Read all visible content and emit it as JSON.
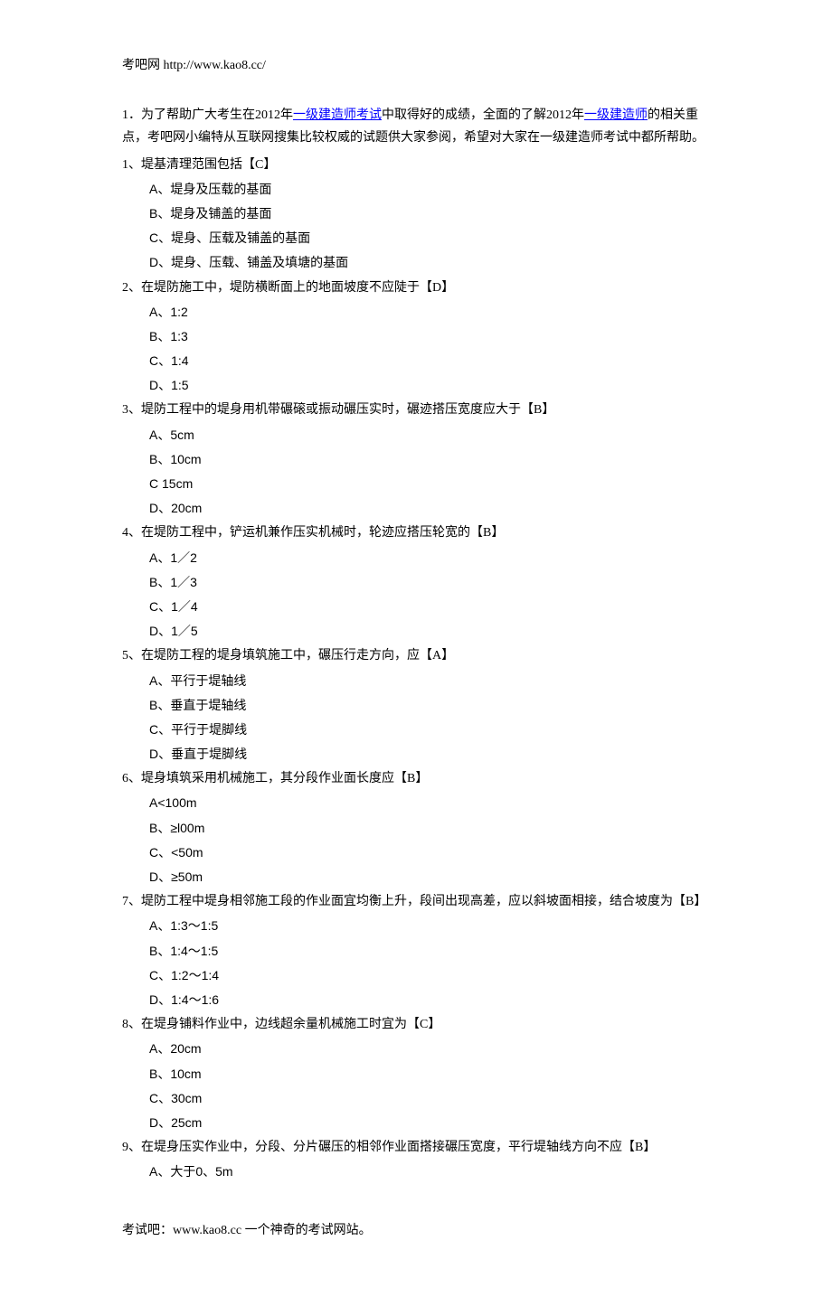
{
  "header": {
    "site_label": "考吧网 http://www.kao8.cc/"
  },
  "intro": {
    "prefix": "1．为了帮助广大考生在2012年",
    "link1_text": "一级建造师考试",
    "mid1": "中取得好的成绩，全面的了解2012年",
    "link2_text": "一级建造师",
    "suffix": "的相关重点，考吧网小编特从互联网搜集比较权威的试题供大家参阅，希望对大家在一级建造师考试中都所帮助。"
  },
  "questions": [
    {
      "stem": "1、堤基清理范围包括【C】",
      "options": [
        "A、堤身及压载的基面",
        "B、堤身及铺盖的基面",
        "C、堤身、压载及铺盖的基面",
        "D、堤身、压载、铺盖及填塘的基面"
      ]
    },
    {
      "stem": "2、在堤防施工中，堤防横断面上的地面坡度不应陡于【D】",
      "options": [
        "A、1:2",
        "B、1:3",
        "C、1:4",
        "D、1:5"
      ]
    },
    {
      "stem": "3、堤防工程中的堤身用机带碾磙或振动碾压实时，碾迹搭压宽度应大于【B】",
      "options": [
        "A、5cm",
        "B、10cm",
        "C 15cm",
        "D、20cm"
      ]
    },
    {
      "stem": "4、在堤防工程中，铲运机兼作压实机械时，轮迹应搭压轮宽的【B】",
      "options": [
        "A、1／2",
        "B、1／3",
        "C、1／4",
        "D、1／5"
      ]
    },
    {
      "stem": "5、在堤防工程的堤身填筑施工中，碾压行走方向，应【A】",
      "options": [
        "A、平行于堤轴线",
        "B、垂直于堤轴线",
        "C、平行于堤脚线",
        "D、垂直于堤脚线"
      ]
    },
    {
      "stem": "6、堤身填筑采用机械施工，其分段作业面长度应【B】",
      "options": [
        "A<100m",
        "B、≥l00m",
        "C、<50m",
        "D、≥50m"
      ]
    },
    {
      "stem": "7、堤防工程中堤身相邻施工段的作业面宜均衡上升，段间出现高差，应以斜坡面相接，结合坡度为【B】",
      "options": [
        "A、1:3～1:5",
        "B、1:4～1:5",
        "C、1:2～1:4",
        "D、1:4～1:6"
      ]
    },
    {
      "stem": "8、在堤身铺料作业中，边线超余量机械施工时宜为【C】",
      "options": [
        "A、20cm",
        "B、10cm",
        "C、30cm",
        "D、25cm"
      ]
    },
    {
      "stem": "9、在堤身压实作业中，分段、分片碾压的相邻作业面搭接碾压宽度，平行堤轴线方向不应【B】",
      "options": [
        "A、大于0、5m"
      ]
    }
  ],
  "footer": {
    "text": "考试吧：www.kao8.cc 一个神奇的考试网站。"
  }
}
